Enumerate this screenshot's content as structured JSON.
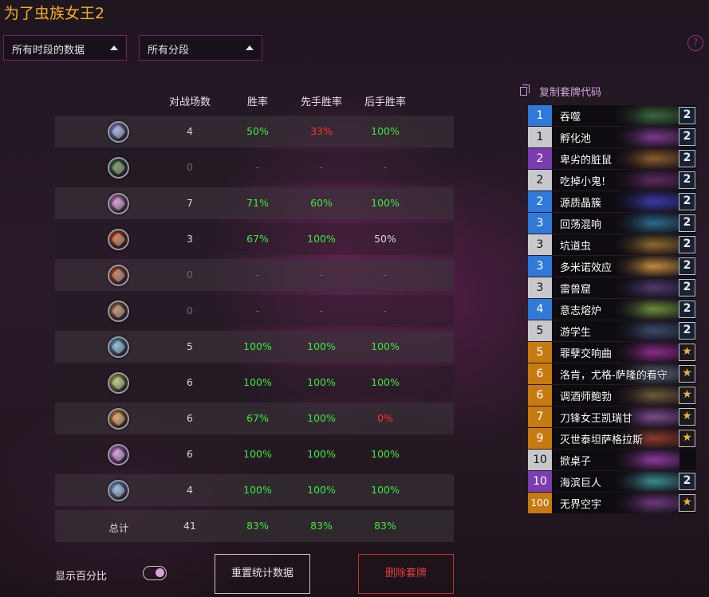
{
  "title": "为了虫族女王2",
  "filters": {
    "time_label": "所有时段的数据",
    "rank_label": "所有分段"
  },
  "table": {
    "headers": [
      "对战场数",
      "胜率",
      "先手胜率",
      "后手胜率"
    ],
    "rows": [
      {
        "icon": "mage-class-icon",
        "games": "4",
        "winrate": "50%",
        "first": "33%",
        "second": "100%",
        "color_win": "#3ee83e",
        "color_first": "#ff3030",
        "color_second": "#3ee83e",
        "icon_color": "#7f8fd8"
      },
      {
        "icon": "druid-class-icon",
        "games": "0",
        "winrate": "-",
        "first": "-",
        "second": "-",
        "color_win": "#6e6570",
        "color_first": "#6e6570",
        "color_second": "#6e6570",
        "icon_color": "#3f6a32"
      },
      {
        "icon": "demon-hunter-class-icon",
        "games": "7",
        "winrate": "71%",
        "first": "60%",
        "second": "100%",
        "color_win": "#3ee83e",
        "color_first": "#3ee83e",
        "color_second": "#3ee83e",
        "icon_color": "#c070b8"
      },
      {
        "icon": "rogue-class-icon",
        "games": "3",
        "winrate": "67%",
        "first": "100%",
        "second": "50%",
        "color_win": "#3ee83e",
        "color_first": "#3ee83e",
        "color_second": "#dad5da",
        "icon_color": "#c04010"
      },
      {
        "icon": "warrior-class-icon",
        "games": "0",
        "winrate": "-",
        "first": "-",
        "second": "-",
        "color_win": "#6e6570",
        "color_first": "#6e6570",
        "color_second": "#6e6570",
        "icon_color": "#b04a20"
      },
      {
        "icon": "warlock-class-icon",
        "games": "0",
        "winrate": "-",
        "first": "-",
        "second": "-",
        "color_win": "#6e6570",
        "color_first": "#6e6570",
        "color_second": "#6e6570",
        "icon_color": "#a06030"
      },
      {
        "icon": "shaman-class-icon",
        "games": "5",
        "winrate": "100%",
        "first": "100%",
        "second": "100%",
        "color_win": "#3ee83e",
        "color_first": "#3ee83e",
        "color_second": "#3ee83e",
        "icon_color": "#5aa0c8"
      },
      {
        "icon": "hunter-class-icon",
        "games": "6",
        "winrate": "100%",
        "first": "100%",
        "second": "100%",
        "color_win": "#3ee83e",
        "color_first": "#3ee83e",
        "color_second": "#3ee83e",
        "icon_color": "#a0b040"
      },
      {
        "icon": "paladin-class-icon",
        "games": "6",
        "winrate": "67%",
        "first": "100%",
        "second": "0%",
        "color_win": "#3ee83e",
        "color_first": "#3ee83e",
        "color_second": "#ff3030",
        "icon_color": "#d08020"
      },
      {
        "icon": "priest-class-icon",
        "games": "6",
        "winrate": "100%",
        "first": "100%",
        "second": "100%",
        "color_win": "#3ee83e",
        "color_first": "#3ee83e",
        "color_second": "#3ee83e",
        "icon_color": "#c070d0"
      },
      {
        "icon": "death-knight-class-icon",
        "games": "4",
        "winrate": "100%",
        "first": "100%",
        "second": "100%",
        "color_win": "#3ee83e",
        "color_first": "#3ee83e",
        "color_second": "#3ee83e",
        "icon_color": "#70a0d0"
      }
    ],
    "total": {
      "label": "总计",
      "games": "41",
      "winrate": "83%",
      "first": "83%",
      "second": "83%"
    }
  },
  "toggle_label": "显示百分比",
  "buttons": {
    "reset": "重置统计数据",
    "delete": "删除套牌"
  },
  "copy_code_label": "复制套牌代码",
  "deck": [
    {
      "cost": "1",
      "name": "吞噬",
      "count": "2",
      "rarity": "rare",
      "art": "#3a6a3a"
    },
    {
      "cost": "1",
      "name": "孵化池",
      "count": "2",
      "rarity": "common",
      "art": "#7a3a8a"
    },
    {
      "cost": "2",
      "name": "卑劣的脏鼠",
      "count": "2",
      "rarity": "epic",
      "art": "#8a5a2a"
    },
    {
      "cost": "2",
      "name": "吃掉小鬼!",
      "count": "2",
      "rarity": "common",
      "art": "#5a2a5a"
    },
    {
      "cost": "2",
      "name": "源质晶簇",
      "count": "2",
      "rarity": "rare",
      "art": "#3a3aaa"
    },
    {
      "cost": "3",
      "name": "回荡混响",
      "count": "2",
      "rarity": "rare",
      "art": "#2a6a8a"
    },
    {
      "cost": "3",
      "name": "坑道虫",
      "count": "2",
      "rarity": "common",
      "art": "#8a6a2a"
    },
    {
      "cost": "3",
      "name": "多米诺效应",
      "count": "2",
      "rarity": "rare",
      "art": "#c08a3a"
    },
    {
      "cost": "3",
      "name": "雷兽窟",
      "count": "2",
      "rarity": "common",
      "art": "#4a3a6a"
    },
    {
      "cost": "4",
      "name": "意志熔炉",
      "count": "2",
      "rarity": "rare",
      "art": "#6a8a3a"
    },
    {
      "cost": "5",
      "name": "游学生",
      "count": "2",
      "rarity": "common",
      "art": "#3a4a6a"
    },
    {
      "cost": "5",
      "name": "罪孽交响曲",
      "count": "★",
      "rarity": "legend",
      "art": "#8a2a8a"
    },
    {
      "cost": "6",
      "name": "洛肯，尤格-萨隆的看守",
      "count": "★",
      "rarity": "legend",
      "art": "#5a6a7a"
    },
    {
      "cost": "6",
      "name": "调酒师鲍勃",
      "count": "★",
      "rarity": "legend",
      "art": "#6a5a3a"
    },
    {
      "cost": "7",
      "name": "刀锋女王凯瑞甘",
      "count": "★",
      "rarity": "legend",
      "art": "#7a4a8a"
    },
    {
      "cost": "9",
      "name": "灭世泰坦萨格拉斯",
      "count": "★",
      "rarity": "legend",
      "art": "#8a3a2a"
    },
    {
      "cost": "10",
      "name": "掀桌子",
      "count": "",
      "rarity": "common",
      "art": "#8a3a9a"
    },
    {
      "cost": "10",
      "name": "海滨巨人",
      "count": "2",
      "rarity": "epic",
      "art": "#3a8a8a"
    },
    {
      "cost": "100",
      "name": "无界空宇",
      "count": "★",
      "rarity": "legend",
      "art": "#6a3a7a"
    }
  ]
}
